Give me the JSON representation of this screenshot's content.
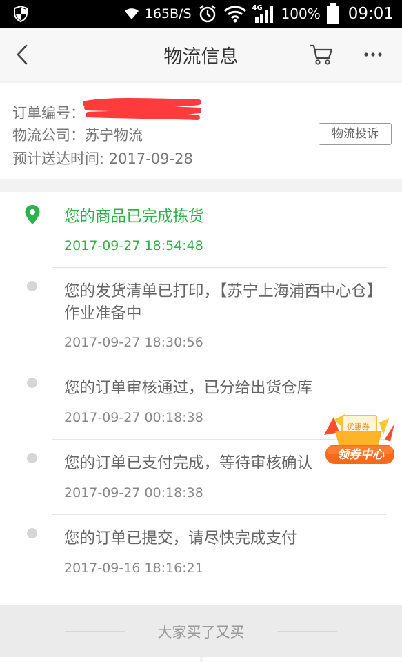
{
  "statusbar": {
    "network_speed": "165B/S",
    "network_type": "4G",
    "battery": "100%",
    "time": "09:01",
    "icons": [
      "shield-icon",
      "wifi-icon",
      "alarm-icon",
      "signal-icon",
      "battery-icon"
    ]
  },
  "navbar": {
    "title": "物流信息",
    "icons": [
      "back-arrow-icon",
      "cart-icon",
      "more-icon"
    ]
  },
  "order": {
    "number_label": "订单编号：",
    "company_label": "物流公司：",
    "company": "苏宁物流",
    "eta_label": "预计送达时间:",
    "eta": "2017-09-28",
    "complain_button": "物流投诉"
  },
  "timeline": [
    {
      "text": "您的商品已完成拣货",
      "time": "2017-09-27 18:54:48",
      "active": true
    },
    {
      "text": "您的发货清单已打印，【苏宁上海浦西中心仓】作业准备中",
      "time": "2017-09-27 18:30:56",
      "active": false
    },
    {
      "text": "您的订单审核通过，已分给出货仓库",
      "time": "2017-09-27 00:18:38",
      "active": false
    },
    {
      "text": "您的订单已支付完成，等待审核确认",
      "time": "2017-09-27 00:18:38",
      "active": false
    },
    {
      "text": "您的订单已提交，请尽快完成支付",
      "time": "2017-09-16 18:16:21",
      "active": false
    }
  ],
  "coupon": {
    "ticket_label": "优惠券",
    "banner": "领券中心"
  },
  "recommend": {
    "title": "大家买了又买"
  },
  "colors": {
    "accent_green": "#2db34a",
    "redaction": "#ff3b3b",
    "coupon_orange": "#f28a1e"
  }
}
